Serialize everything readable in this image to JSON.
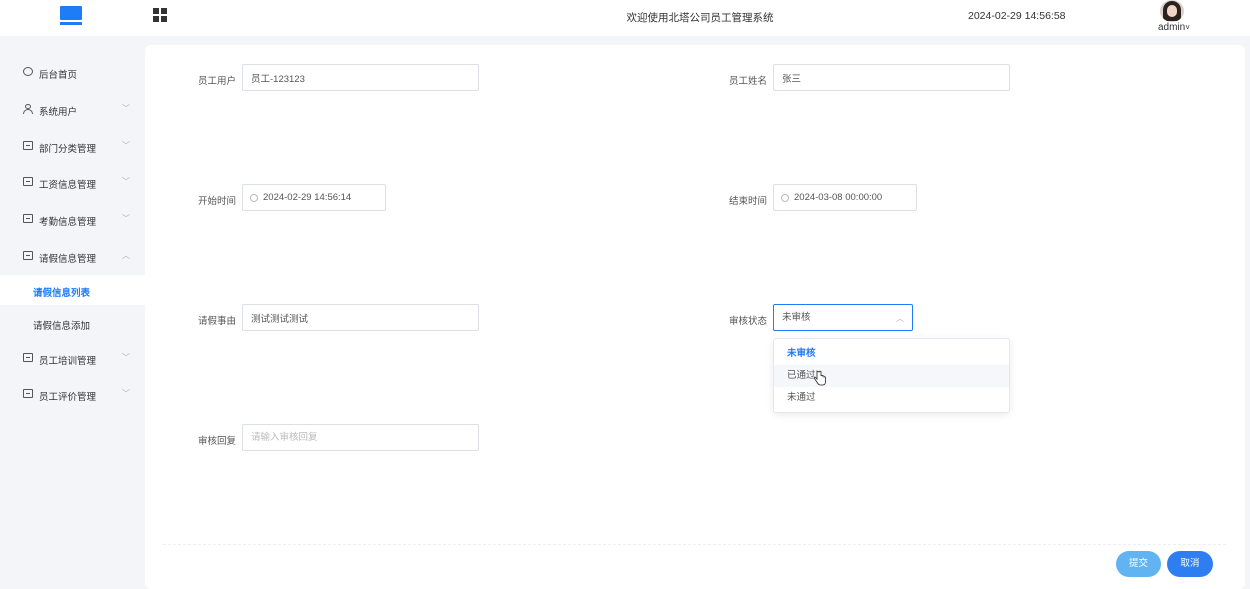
{
  "header": {
    "title": "欢迎使用北塔公司员工管理系统",
    "datetime": "2024-02-29 14:56:58",
    "username": "admin",
    "user_caret": "˅"
  },
  "sidebar": {
    "items": [
      {
        "label": "后台首页",
        "icon": "clock-icon"
      },
      {
        "label": "系统用户",
        "icon": "user-icon",
        "chevron": "﹀"
      },
      {
        "label": "部门分类管理",
        "icon": "folder-icon",
        "chevron": "﹀"
      },
      {
        "label": "工资信息管理",
        "icon": "folder-icon",
        "chevron": "﹀"
      },
      {
        "label": "考勤信息管理",
        "icon": "folder-icon",
        "chevron": "﹀"
      },
      {
        "label": "请假信息管理",
        "icon": "folder-icon",
        "chevron": "︿"
      },
      {
        "label": "员工培训管理",
        "icon": "folder-icon",
        "chevron": "﹀"
      },
      {
        "label": "员工评价管理",
        "icon": "folder-icon",
        "chevron": "﹀"
      }
    ],
    "sub_items": [
      {
        "label": "请假信息列表",
        "active": true
      },
      {
        "label": "请假信息添加",
        "active": false
      }
    ]
  },
  "form": {
    "employee_account": {
      "label": "员工用户",
      "value": "员工-123123"
    },
    "employee_name": {
      "label": "员工姓名",
      "value": "张三"
    },
    "start_time": {
      "label": "开始时间",
      "value": "2024-02-29 14:56:14"
    },
    "end_time": {
      "label": "结束时间",
      "value": "2024-03-08 00:00:00"
    },
    "reason": {
      "label": "请假事由",
      "value": "测试测试测试"
    },
    "review_status": {
      "label": "审核状态",
      "value": "未审核",
      "caret": "︿",
      "options": [
        "未审核",
        "已通过",
        "未通过"
      ],
      "selected_index": 0,
      "hover_index": 1
    },
    "review_reply": {
      "label": "审核回复",
      "placeholder": "请输入审核回复",
      "value": ""
    }
  },
  "actions": {
    "submit_label": "提交",
    "cancel_label": "取消"
  },
  "colors": {
    "accent": "#1e7cf7",
    "submit_button": "#61b3f1",
    "cancel_button": "#2e7ef1"
  }
}
